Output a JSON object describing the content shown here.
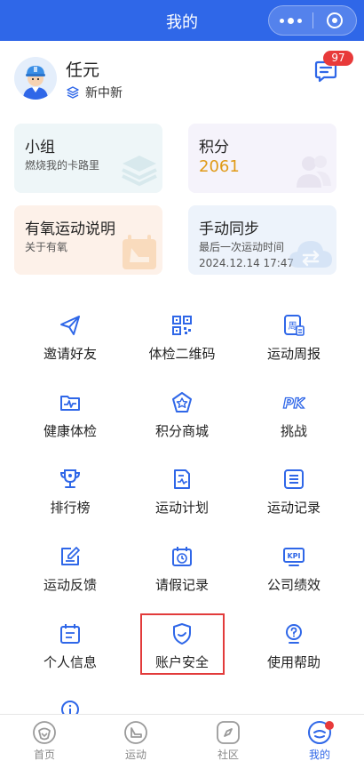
{
  "header": {
    "title": "我的"
  },
  "profile": {
    "name": "任元",
    "org": "新中新",
    "message_badge": "97"
  },
  "cards": {
    "group": {
      "title": "小组",
      "subtitle": "燃烧我的卡路里"
    },
    "points": {
      "title": "积分",
      "value": "2061"
    },
    "aerobic": {
      "title": "有氧运动说明",
      "subtitle": "关于有氧"
    },
    "sync": {
      "title": "手动同步",
      "subtitle": "最后一次运动时间",
      "date": "2024.12.14 17:47"
    }
  },
  "grid": [
    {
      "label": "邀请好友",
      "icon": "paper-plane-icon"
    },
    {
      "label": "体检二维码",
      "icon": "qr-code-icon"
    },
    {
      "label": "运动周报",
      "icon": "weekly-report-icon"
    },
    {
      "label": "健康体检",
      "icon": "health-check-icon"
    },
    {
      "label": "积分商城",
      "icon": "points-mall-icon"
    },
    {
      "label": "挑战",
      "icon": "pk-icon"
    },
    {
      "label": "排行榜",
      "icon": "trophy-icon"
    },
    {
      "label": "运动计划",
      "icon": "plan-icon"
    },
    {
      "label": "运动记录",
      "icon": "record-icon"
    },
    {
      "label": "运动反馈",
      "icon": "feedback-icon"
    },
    {
      "label": "请假记录",
      "icon": "leave-calendar-icon"
    },
    {
      "label": "公司绩效",
      "icon": "kpi-icon"
    },
    {
      "label": "个人信息",
      "icon": "personal-info-icon"
    },
    {
      "label": "账户安全",
      "icon": "shield-icon"
    },
    {
      "label": "使用帮助",
      "icon": "help-icon"
    }
  ],
  "tabs": [
    {
      "label": "首页",
      "icon": "home-icon"
    },
    {
      "label": "运动",
      "icon": "run-icon"
    },
    {
      "label": "社区",
      "icon": "compass-icon"
    },
    {
      "label": "我的",
      "icon": "profile-icon"
    }
  ],
  "colors": {
    "primary": "#2f67e8",
    "badge": "#e83a3a",
    "points": "#e09a16",
    "highlight": "#e23b3b"
  }
}
